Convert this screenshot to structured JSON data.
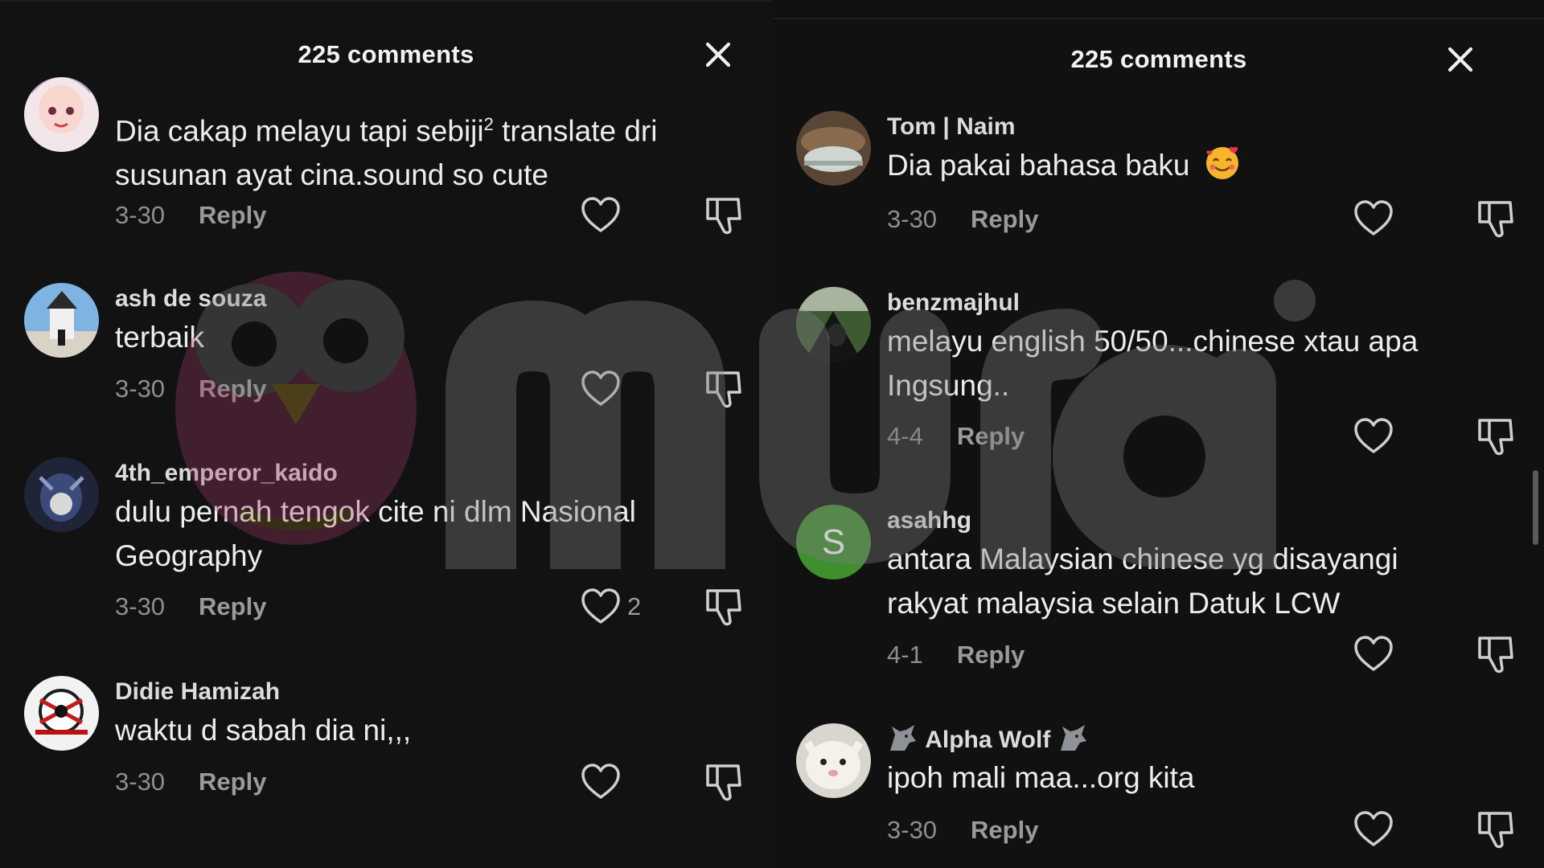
{
  "left_panel": {
    "title": "225 comments",
    "comments": [
      {
        "username": "",
        "text_line1": "Dia cakap melayu tapi sebiji",
        "superscript": "2",
        "text_line1_rest": " translate dri",
        "text_line2": "susunan ayat cina.sound so cute",
        "date": "3-30",
        "reply": "Reply",
        "likes": ""
      },
      {
        "username": "ash de souza",
        "text_line1": "terbaik",
        "date": "3-30",
        "reply": "Reply",
        "likes": ""
      },
      {
        "username": "4th_emperor_kaido",
        "text_line1": "dulu pernah tengok cite ni dlm Nasional",
        "text_line2": "Geography",
        "date": "3-30",
        "reply": "Reply",
        "likes": "2"
      },
      {
        "username": "Didie Hamizah",
        "text_line1": "waktu d sabah dia ni,,,",
        "date": "3-30",
        "reply": "Reply",
        "likes": ""
      }
    ]
  },
  "right_panel": {
    "title": "225 comments",
    "comments": [
      {
        "username": "Tom | Naim",
        "text_line1": "Dia pakai bahasa baku",
        "emoji": "smiling-face-with-hearts",
        "date": "3-30",
        "reply": "Reply",
        "likes": ""
      },
      {
        "username": "benzmajhul",
        "text_line1": "melayu english 50/50...chinese xtau apa",
        "text_line2": "Ingsung..",
        "date": "4-4",
        "reply": "Reply",
        "likes": ""
      },
      {
        "username": "asahhg",
        "avatar_letter": "S",
        "text_line1": "antara Malaysian chinese yg disayangi",
        "text_line2": "rakyat malaysia selain Datuk LCW",
        "date": "4-1",
        "reply": "Reply",
        "likes": ""
      },
      {
        "username": "Alpha Wolf",
        "username_icons": "wolf-icon",
        "text_line1": "ipoh mali maa...org kita",
        "date": "3-30",
        "reply": "Reply",
        "likes": ""
      }
    ]
  },
  "watermark": {
    "text": "murai",
    "logo": "owl-icon"
  },
  "colors": {
    "background": "#121212",
    "text": "#ededed",
    "muted": "#8e8e8e",
    "avatar_green": "#3f8f2f"
  }
}
